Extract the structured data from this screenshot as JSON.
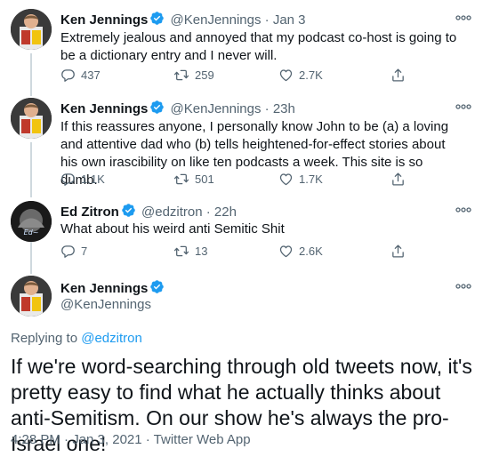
{
  "tweets": [
    {
      "name": "Ken Jennings",
      "handle": "@KenJennings",
      "time": "· Jan 3",
      "text": "Extremely jealous and annoyed that my podcast co-host is going to be a dictionary entry and I never will.",
      "replies": "437",
      "retweets": "259",
      "likes": "2.7K"
    },
    {
      "name": "Ken Jennings",
      "handle": "@KenJennings",
      "time": "· 23h",
      "text": "If this reassures anyone, I personally know John to be (a) a loving and attentive dad who (b) tells heightened-for-effect stories about his own irascibility on like ten podcasts a week. This site is so dumb.",
      "replies": "1.1K",
      "retweets": "501",
      "likes": "1.7K"
    },
    {
      "name": "Ed Zitron",
      "handle": "@edzitron",
      "time": "· 22h",
      "text": "What about his weird anti Semitic Shit",
      "replies": "7",
      "retweets": "13",
      "likes": "2.6K"
    }
  ],
  "focused": {
    "name": "Ken Jennings",
    "handle": "@KenJennings",
    "replying_prefix": "Replying to ",
    "replying_to": "@edzitron",
    "text": "If we're word-searching through old tweets now, it's pretty easy to find what he actually thinks about anti-Semitism. On our show he's always the pro-Israel one!",
    "timestamp": "4:28 PM · Jan 3, 2021 · ",
    "source": "Twitter Web App"
  },
  "colors": {
    "accent": "#1d9bf0",
    "secondary_text": "#536471"
  },
  "icons": [
    "verified-badge-icon",
    "more-icon",
    "reply-icon",
    "retweet-icon",
    "like-icon",
    "share-icon"
  ]
}
